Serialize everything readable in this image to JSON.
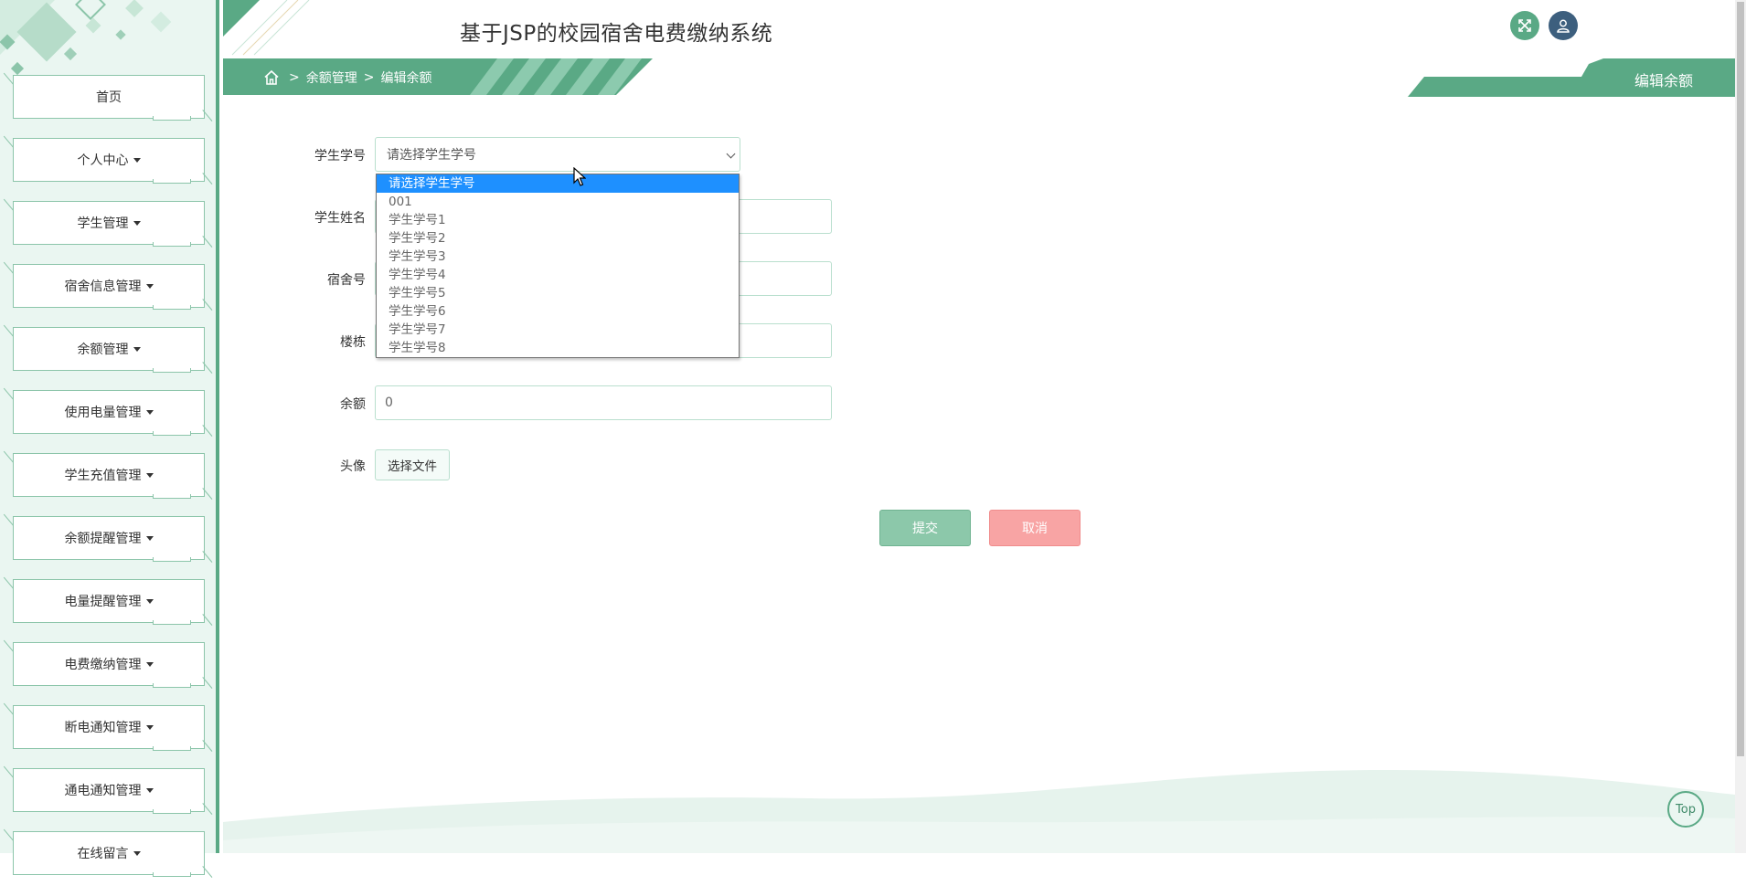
{
  "app": {
    "title": "基于JSP的校园宿舍电费缴纳系统"
  },
  "colors": {
    "primary": "#5aa985",
    "sidebar_bg": "#eaf6f1",
    "submit": "#8cc8aa",
    "cancel": "#f8a4a4",
    "selected_option": "#1e90ff"
  },
  "header": {
    "fullscreen_icon": "expand-icon",
    "user_icon": "user-icon"
  },
  "breadcrumb": {
    "home_icon": "home-icon",
    "sep1": ">",
    "level1": "余额管理",
    "sep2": ">",
    "level2": "编辑余额"
  },
  "page_tab": {
    "label": "编辑余额"
  },
  "sidebar": {
    "items": [
      {
        "label": "首页",
        "dropdown": false
      },
      {
        "label": "个人中心",
        "dropdown": true
      },
      {
        "label": "学生管理",
        "dropdown": true
      },
      {
        "label": "宿舍信息管理",
        "dropdown": true
      },
      {
        "label": "余额管理",
        "dropdown": true
      },
      {
        "label": "使用电量管理",
        "dropdown": true
      },
      {
        "label": "学生充值管理",
        "dropdown": true
      },
      {
        "label": "余额提醒管理",
        "dropdown": true
      },
      {
        "label": "电量提醒管理",
        "dropdown": true
      },
      {
        "label": "电费缴纳管理",
        "dropdown": true
      },
      {
        "label": "断电通知管理",
        "dropdown": true
      },
      {
        "label": "通电通知管理",
        "dropdown": true
      },
      {
        "label": "在线留言",
        "dropdown": true
      }
    ]
  },
  "form": {
    "student_no": {
      "label": "学生学号",
      "selected": "请选择学生学号"
    },
    "student_name": {
      "label": "学生姓名",
      "value": ""
    },
    "dorm_no": {
      "label": "宿舍号",
      "value": ""
    },
    "building": {
      "label": "楼栋",
      "value": ""
    },
    "balance": {
      "label": "余额",
      "value": "0"
    },
    "avatar": {
      "label": "头像",
      "button": "选择文件"
    },
    "submit_label": "提交",
    "cancel_label": "取消"
  },
  "dropdown": {
    "options": [
      "请选择学生学号",
      "001",
      "学生学号1",
      "学生学号2",
      "学生学号3",
      "学生学号4",
      "学生学号5",
      "学生学号6",
      "学生学号7",
      "学生学号8"
    ],
    "selected_index": 0
  },
  "top_button": {
    "label": "Top"
  }
}
